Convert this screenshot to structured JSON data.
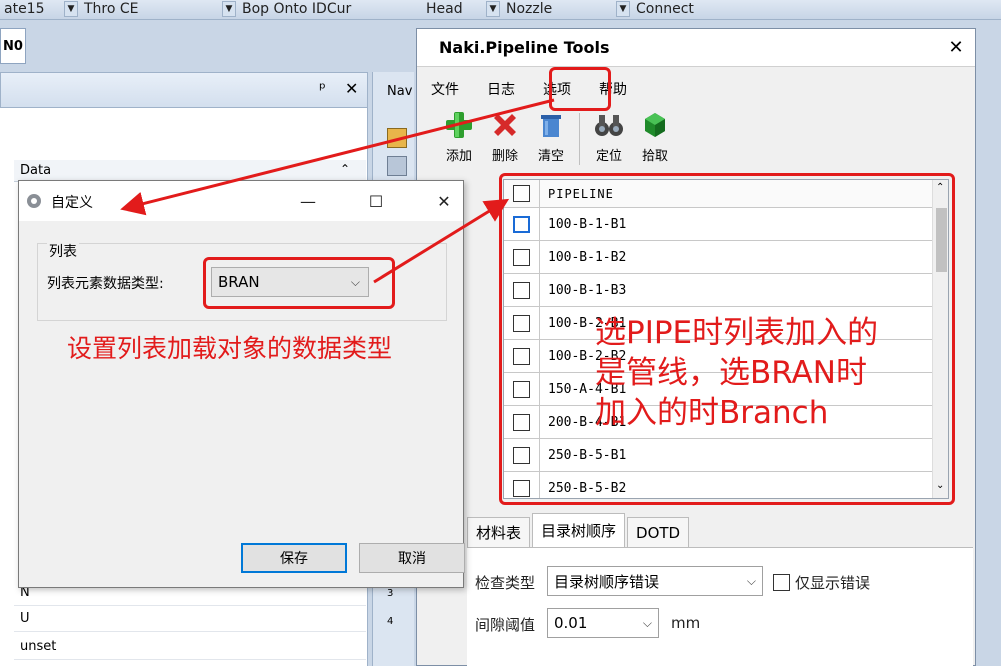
{
  "top_toolbar": {
    "combos": [
      {
        "label": "ate15"
      },
      {
        "label": "Thro CE"
      },
      {
        "label": "Bop Onto IDCur"
      },
      {
        "label": "Head"
      },
      {
        "label": "Nozzle"
      },
      {
        "label": "Connect"
      }
    ]
  },
  "background_window": {
    "tab_label": "N0",
    "panel_pin": "ᵖ",
    "panel_close": "✕",
    "grid_header": "Data",
    "rows": [
      "N",
      "U",
      "unset"
    ],
    "mid_strip_label": "Nav",
    "mid_numbers": [
      "3",
      "4"
    ]
  },
  "naki_window": {
    "title": "Naki.Pipeline Tools",
    "close_glyph": "✕",
    "menu": [
      "文件",
      "日志",
      "选项",
      "帮助"
    ],
    "toolbar": [
      {
        "label": "添加",
        "icon": "add-plus-icon"
      },
      {
        "label": "删除",
        "icon": "delete-x-icon"
      },
      {
        "label": "清空",
        "icon": "clear-bin-icon"
      },
      {
        "label": "定位",
        "icon": "binoculars-icon"
      },
      {
        "label": "拾取",
        "icon": "pick-cube-icon"
      }
    ],
    "list_header": "PIPELINE",
    "pipelines": [
      "100-B-1-B1",
      "100-B-1-B2",
      "100-B-1-B3",
      "100-B-2-B1",
      "100-B-2-B2",
      "150-A-4-B1",
      "200-B-4-B1",
      "250-B-5-B1",
      "250-B-5-B2"
    ],
    "tabs": [
      "材料表",
      "目录树顺序",
      "DOTD"
    ],
    "active_tab": "目录树顺序",
    "check_type_label": "检查类型",
    "check_type_value": "目录树顺序错误",
    "only_errors_label": "仅显示错误",
    "threshold_label": "间隙阈值",
    "threshold_value": "0.01",
    "threshold_unit": "mm"
  },
  "dialog": {
    "title": "自定义",
    "minimize_glyph": "—",
    "maximize_glyph": "☐",
    "close_glyph": "✕",
    "group_label": "列表",
    "field_label": "列表元素数据类型:",
    "field_value": "BRAN",
    "save_label": "保存",
    "cancel_label": "取消"
  },
  "annotations": {
    "dialog_note": "设置列表加载对象的数据类型",
    "list_note_lines": [
      "选PIPE时列表加入的",
      "是管线，选BRAN时",
      "加入的时Branch"
    ]
  },
  "colors": {
    "annotation_red": "#e21b1b",
    "focus_blue": "#0078d7"
  }
}
